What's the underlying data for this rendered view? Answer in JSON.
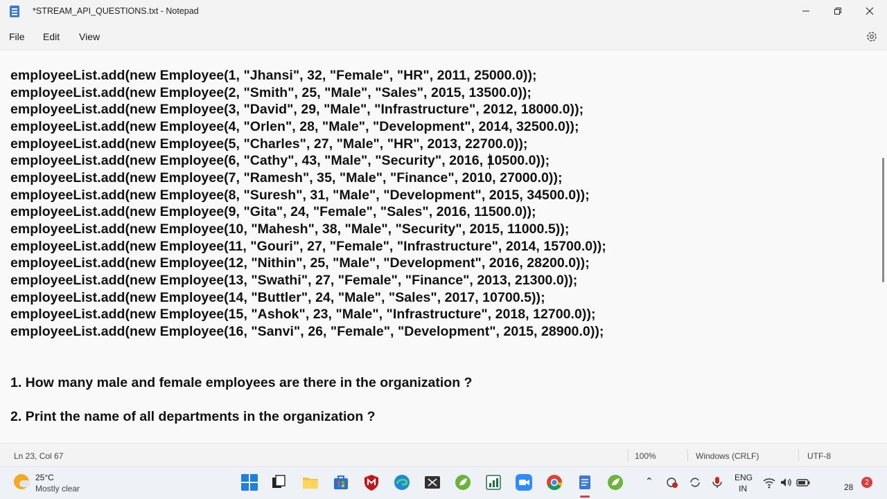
{
  "window": {
    "title": "*STREAM_API_QUESTIONS.txt - Notepad"
  },
  "menu": {
    "file": "File",
    "edit": "Edit",
    "view": "View"
  },
  "editor": {
    "lines": [
      "employeeList.add(new Employee(1, \"Jhansi\", 32, \"Female\", \"HR\", 2011, 25000.0));",
      "employeeList.add(new Employee(2, \"Smith\", 25, \"Male\", \"Sales\", 2015, 13500.0));",
      "employeeList.add(new Employee(3, \"David\", 29, \"Male\", \"Infrastructure\", 2012, 18000.0));",
      "employeeList.add(new Employee(4, \"Orlen\", 28, \"Male\", \"Development\", 2014, 32500.0));",
      "employeeList.add(new Employee(5, \"Charles\", 27, \"Male\", \"HR\", 2013, 22700.0));",
      "employeeList.add(new Employee(6, \"Cathy\", 43, \"Male\", \"Security\", 2016, 10500.0));",
      "employeeList.add(new Employee(7, \"Ramesh\", 35, \"Male\", \"Finance\", 2010, 27000.0));",
      "employeeList.add(new Employee(8, \"Suresh\", 31, \"Male\", \"Development\", 2015, 34500.0));",
      "employeeList.add(new Employee(9, \"Gita\", 24, \"Female\", \"Sales\", 2016, 11500.0));",
      "employeeList.add(new Employee(10, \"Mahesh\", 38, \"Male\", \"Security\", 2015, 11000.5));",
      "employeeList.add(new Employee(11, \"Gouri\", 27, \"Female\", \"Infrastructure\", 2014, 15700.0));",
      "employeeList.add(new Employee(12, \"Nithin\", 25, \"Male\", \"Development\", 2016, 28200.0));",
      "employeeList.add(new Employee(13, \"Swathi\", 27, \"Female\", \"Finance\", 2013, 21300.0));",
      "employeeList.add(new Employee(14, \"Buttler\", 24, \"Male\", \"Sales\", 2017, 10700.5));",
      "employeeList.add(new Employee(15, \"Ashok\", 23, \"Male\", \"Infrastructure\", 2018, 12700.0));",
      "employeeList.add(new Employee(16, \"Sanvi\", 26, \"Female\", \"Development\", 2015, 28900.0));"
    ],
    "questions": [
      "1. How many male and female employees are there in the organization ?",
      "2. Print the name of all departments in the organization ?"
    ]
  },
  "status": {
    "position": "Ln 23, Col 67",
    "zoom": "100%",
    "line_ending": "Windows (CRLF)",
    "encoding": "UTF-8"
  },
  "taskbar": {
    "weather_temp": "25°C",
    "weather_desc": "Mostly clear",
    "lang_top": "ENG",
    "lang_bottom": "IN",
    "clock": "28",
    "notification_count": "2"
  }
}
